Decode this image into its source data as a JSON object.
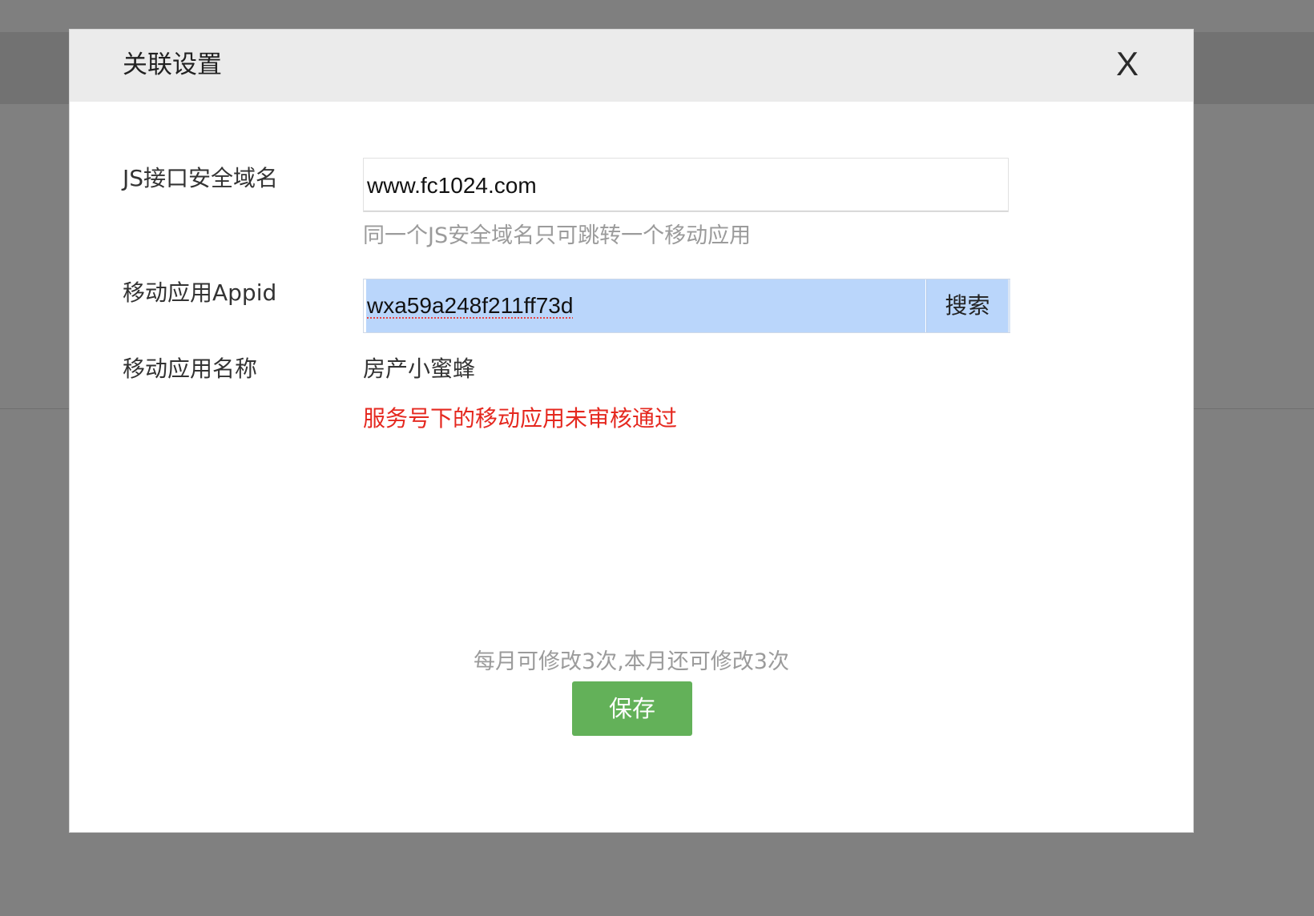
{
  "dialog": {
    "title": "关联设置",
    "close_label": "X"
  },
  "form": {
    "domain": {
      "label": "JS接口安全域名",
      "value": "www.fc1024.com",
      "hint": "同一个JS安全域名只可跳转一个移动应用"
    },
    "appid": {
      "label": "移动应用Appid",
      "value": "wxa59a248f211ff73d",
      "search_label": "搜索"
    },
    "app_name": {
      "label": "移动应用名称",
      "value": "房产小蜜蜂",
      "error": "服务号下的移动应用未审核通过"
    }
  },
  "footer": {
    "quota_text": "每月可修改3次,本月还可修改3次",
    "save_label": "保存"
  },
  "colors": {
    "overlay": "#808080",
    "header_bg": "#ebebeb",
    "selection": "#bad6fb",
    "error": "#e5281f",
    "primary_button": "#63b159",
    "hint_text": "#9b9b9b"
  }
}
